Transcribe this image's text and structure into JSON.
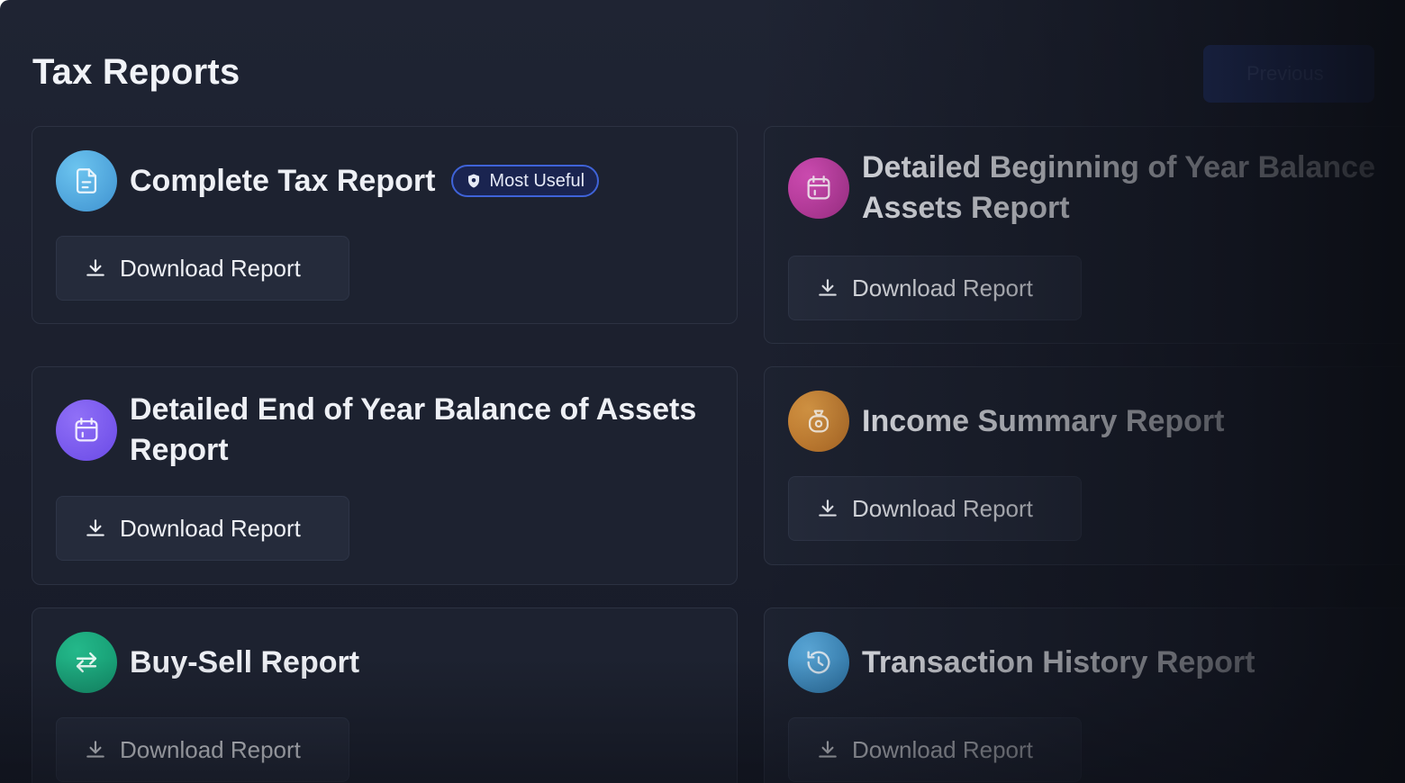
{
  "page": {
    "title": "Tax Reports",
    "previous_label": "Previous"
  },
  "reports": [
    {
      "title": "Complete Tax Report",
      "icon": "document-icon",
      "icon_color": "#4ea8de",
      "badge": "Most Useful",
      "download_label": "Download Report"
    },
    {
      "title": "Detailed Beginning of Year Balance of Assets Report",
      "title_line1": "Detailed Beginning of Year Balance",
      "title_line2": "Assets Report",
      "icon": "calendar-icon",
      "icon_color": "#c13aa3",
      "download_label": "Download Report"
    },
    {
      "title_line1": "Detailed End of Year Balance of Assets",
      "title_line2": "Report",
      "icon": "calendar-icon",
      "icon_color": "#7b5cf0",
      "download_label": "Download Report"
    },
    {
      "title": "Income Summary Report",
      "icon": "money-bag-icon",
      "icon_color": "#c98232",
      "download_label": "Download Report"
    },
    {
      "title": "Buy-Sell Report",
      "icon": "swap-arrows-icon",
      "icon_color": "#1aa37a",
      "download_label": "Download Report"
    },
    {
      "title": "Transaction History Report",
      "icon": "history-clock-icon",
      "icon_color": "#3b8ec4",
      "download_label": "Download Report"
    }
  ]
}
